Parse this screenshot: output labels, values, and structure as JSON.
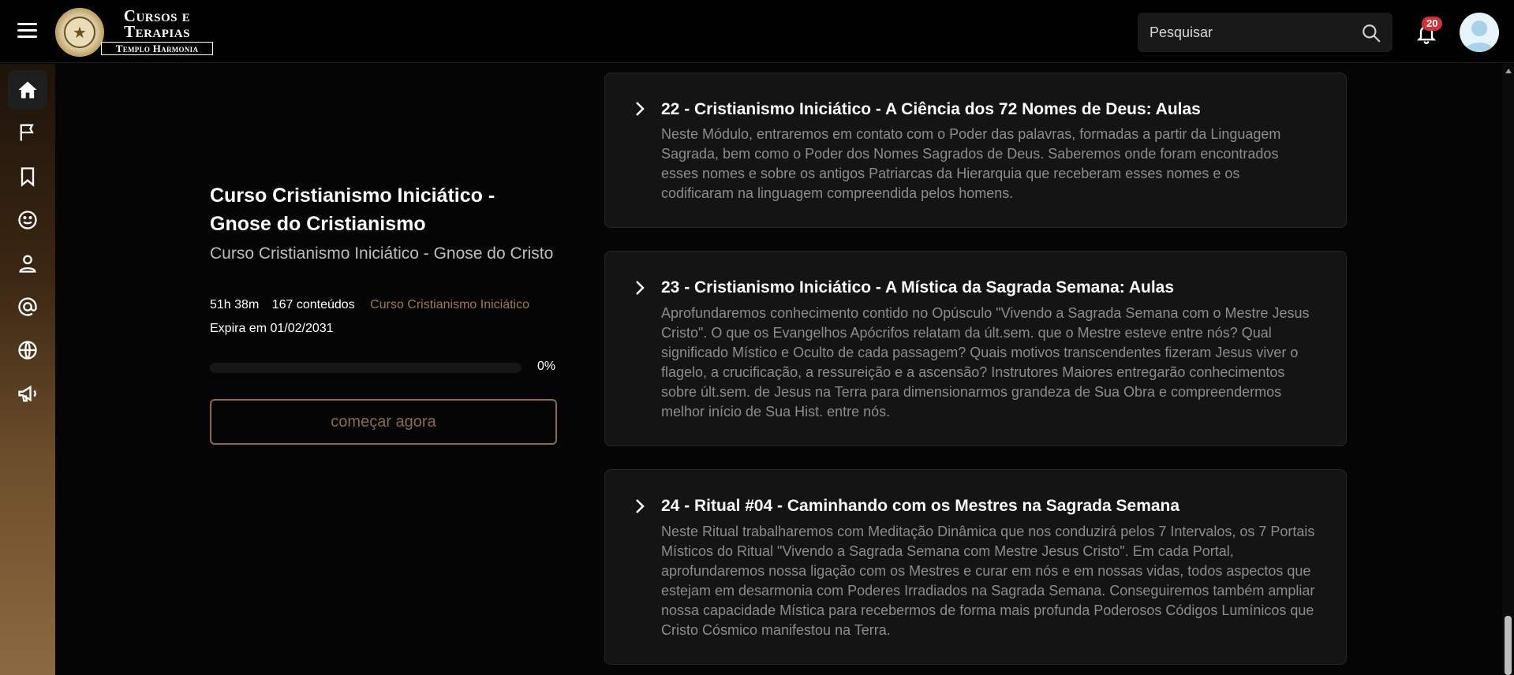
{
  "header": {
    "brand_line1": "Cursos e",
    "brand_line2": "Terapias",
    "brand_line3": "Templo Harmonia",
    "search_placeholder": "Pesquisar",
    "notification_count": "20"
  },
  "sidebar": {
    "items": [
      {
        "name": "home",
        "icon": "home-icon",
        "active": true
      },
      {
        "name": "flag",
        "icon": "flag-icon"
      },
      {
        "name": "bookmark",
        "icon": "bookmark-icon"
      },
      {
        "name": "smile",
        "icon": "smile-icon"
      },
      {
        "name": "profile",
        "icon": "user-icon"
      },
      {
        "name": "at",
        "icon": "at-icon"
      },
      {
        "name": "globe",
        "icon": "globe-icon"
      },
      {
        "name": "megaphone",
        "icon": "megaphone-icon"
      }
    ]
  },
  "course": {
    "title": "Curso Cristianismo Iniciático - Gnose do Cristianismo",
    "subtitle": "Curso Cristianismo Iniciático - Gnose do Cristo",
    "duration": "51h 38m",
    "contents": "167 conteúdos",
    "category": "Curso Cristianismo Iniciático",
    "expires": "Expira em 01/02/2031",
    "progress_percent": 0,
    "progress_label": "0%",
    "start_button": "começar agora"
  },
  "modules": [
    {
      "title": "22 - Cristianismo Iniciático - A Ciência dos 72 Nomes de Deus: Aulas",
      "description": "Neste Módulo, entraremos em contato com o Poder das palavras, formadas a partir da Linguagem Sagrada, bem como o Poder dos Nomes Sagrados de Deus. Saberemos onde foram encontrados esses nomes e sobre os antigos Patriarcas da Hierarquia que receberam esses nomes e os codificaram na linguagem compreendida pelos homens."
    },
    {
      "title": "23 - Cristianismo Iniciático - A Mística da Sagrada Semana: Aulas",
      "description": "Aprofundaremos conhecimento contido no Opúsculo \"Vivendo a Sagrada Semana com o Mestre Jesus Cristo\". O que os Evangelhos Apócrifos relatam da últ.sem. que o Mestre esteve entre nós? Qual significado Místico e Oculto de cada passagem? Quais motivos transcendentes fizeram Jesus viver o flagelo, a crucificação, a ressureição e a ascensão? Instrutores Maiores entregarão conhecimentos sobre últ.sem. de Jesus na Terra para dimensionarmos grandeza de Sua Obra e compreendermos melhor início de Sua Hist. entre nós."
    },
    {
      "title": "24 - Ritual #04 - Caminhando com os Mestres na Sagrada Semana",
      "description": "Neste Ritual trabalharemos com Meditação Dinâmica que nos conduzirá pelos 7 Intervalos, os 7 Portais Místicos do Ritual \"Vivendo a Sagrada Semana com Mestre Jesus Cristo\". Em cada Portal, aprofundaremos nossa ligação com os Mestres e curar em nós e em nossas vidas, todos aspectos que estejam em desarmonia com Poderes Irradiados na Sagrada Semana. Conseguiremos também ampliar nossa capacidade Mística para recebermos de forma mais profunda Poderosos Códigos Lumínicos que Cristo Cósmico manifestou na Terra."
    }
  ]
}
